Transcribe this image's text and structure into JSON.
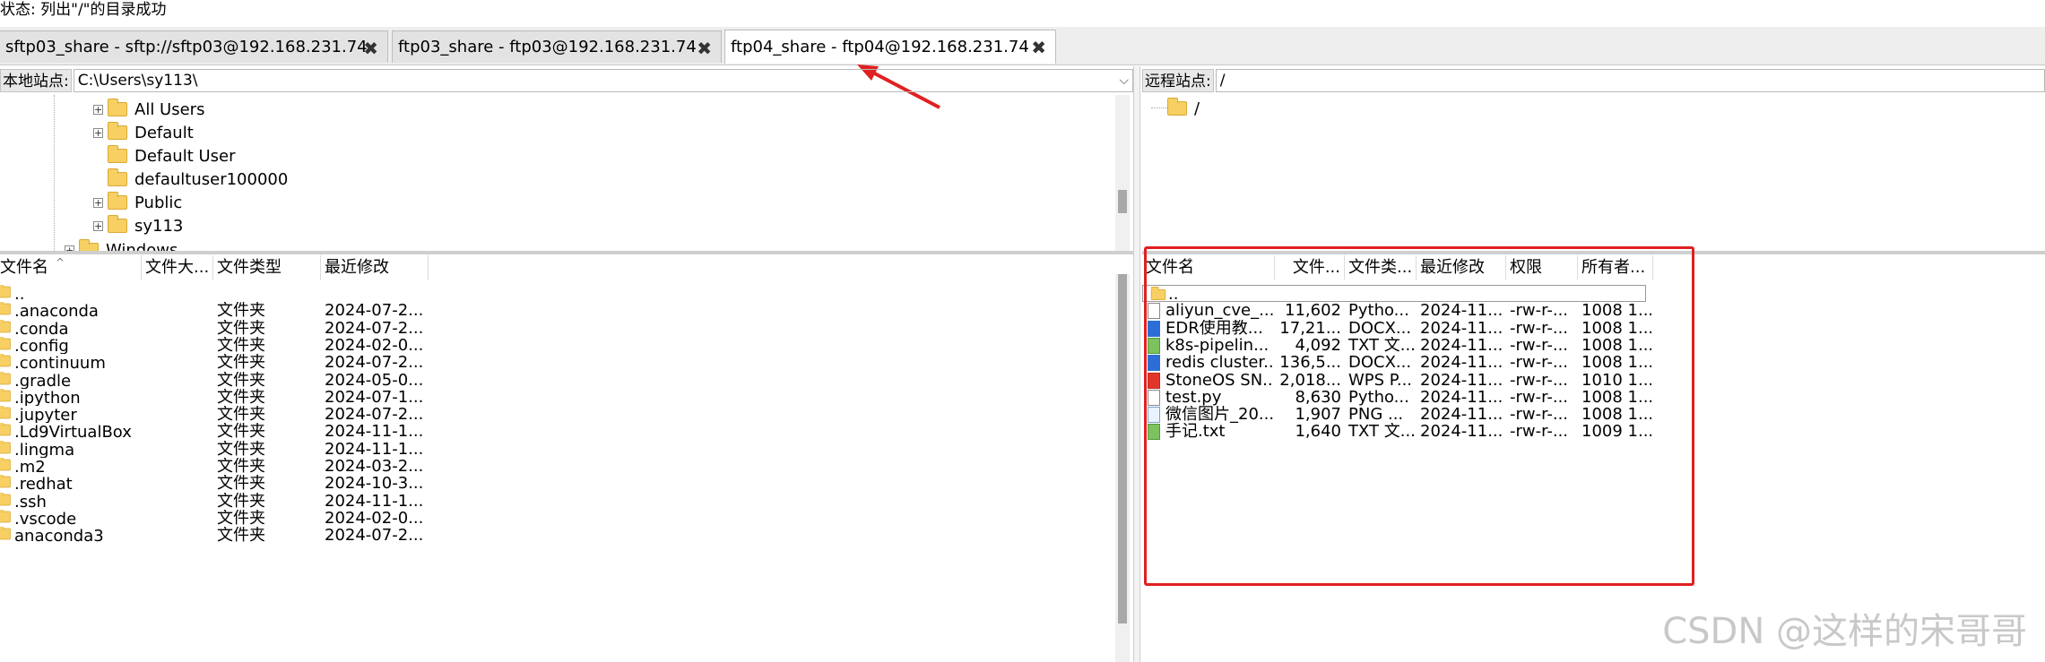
{
  "status_line": "状态: 列出\"/\"的目录成功",
  "tabs": [
    {
      "label": "sftp03_share - sftp://sftp03@192.168.231.74",
      "close": "✖"
    },
    {
      "label": "ftp03_share - ftp03@192.168.231.74",
      "close": "✖"
    },
    {
      "label": "ftp04_share - ftp04@192.168.231.74",
      "close": "✖"
    }
  ],
  "local": {
    "site_label": "本地站点:",
    "path": "C:\\Users\\sy113\\",
    "tree": [
      {
        "label": "All Users",
        "expander": "+"
      },
      {
        "label": "Default",
        "expander": "+"
      },
      {
        "label": "Default User",
        "expander": ""
      },
      {
        "label": "defaultuser100000",
        "expander": ""
      },
      {
        "label": "Public",
        "expander": "+"
      },
      {
        "label": "sy113",
        "expander": "+"
      },
      {
        "label": "Windows",
        "expander": "+"
      }
    ],
    "columns": [
      "文件名",
      "文件大...",
      "文件类型",
      "最近修改"
    ],
    "rows": [
      {
        "name": "..",
        "size": "",
        "type": "",
        "modified": ""
      },
      {
        "name": ".anaconda",
        "size": "",
        "type": "文件夹",
        "modified": "2024-07-2..."
      },
      {
        "name": ".conda",
        "size": "",
        "type": "文件夹",
        "modified": "2024-07-2..."
      },
      {
        "name": ".config",
        "size": "",
        "type": "文件夹",
        "modified": "2024-02-0..."
      },
      {
        "name": ".continuum",
        "size": "",
        "type": "文件夹",
        "modified": "2024-07-2..."
      },
      {
        "name": ".gradle",
        "size": "",
        "type": "文件夹",
        "modified": "2024-05-0..."
      },
      {
        "name": ".ipython",
        "size": "",
        "type": "文件夹",
        "modified": "2024-07-1..."
      },
      {
        "name": ".jupyter",
        "size": "",
        "type": "文件夹",
        "modified": "2024-07-2..."
      },
      {
        "name": ".Ld9VirtualBox",
        "size": "",
        "type": "文件夹",
        "modified": "2024-11-1..."
      },
      {
        "name": ".lingma",
        "size": "",
        "type": "文件夹",
        "modified": "2024-11-1..."
      },
      {
        "name": ".m2",
        "size": "",
        "type": "文件夹",
        "modified": "2024-03-2..."
      },
      {
        "name": ".redhat",
        "size": "",
        "type": "文件夹",
        "modified": "2024-10-3..."
      },
      {
        "name": ".ssh",
        "size": "",
        "type": "文件夹",
        "modified": "2024-11-1..."
      },
      {
        "name": ".vscode",
        "size": "",
        "type": "文件夹",
        "modified": "2024-02-0..."
      },
      {
        "name": "anaconda3",
        "size": "",
        "type": "文件夹",
        "modified": "2024-07-2..."
      }
    ]
  },
  "remote": {
    "site_label": "远程站点:",
    "path": "/",
    "tree": [
      {
        "label": "/"
      }
    ],
    "columns": [
      "文件名",
      "文件...",
      "文件类...",
      "最近修改",
      "权限",
      "所有者..."
    ],
    "rows": [
      {
        "name": "..",
        "size": "",
        "type": "",
        "modified": "",
        "perm": "",
        "owner": "",
        "icon": "folder-icon"
      },
      {
        "name": "aliyun_cve_...",
        "size": "11,602",
        "type": "Pytho...",
        "modified": "2024-11...",
        "perm": "-rw-r-...",
        "owner": "1008 1...",
        "icon": "file-icon"
      },
      {
        "name": "EDR使用教...",
        "size": "17,21...",
        "type": "DOCX...",
        "modified": "2024-11...",
        "perm": "-rw-r-...",
        "owner": "1008 1...",
        "icon": "docx-icon"
      },
      {
        "name": "k8s-pipelin...",
        "size": "4,092",
        "type": "TXT 文...",
        "modified": "2024-11...",
        "perm": "-rw-r-...",
        "owner": "1008 1...",
        "icon": "txt-icon"
      },
      {
        "name": "redis cluster...",
        "size": "136,5...",
        "type": "DOCX...",
        "modified": "2024-11...",
        "perm": "-rw-r-...",
        "owner": "1008 1...",
        "icon": "docx-icon"
      },
      {
        "name": "StoneOS SN...",
        "size": "2,018...",
        "type": "WPS P...",
        "modified": "2024-11...",
        "perm": "-rw-r-...",
        "owner": "1010 1...",
        "icon": "wps-icon"
      },
      {
        "name": "test.py",
        "size": "8,630",
        "type": "Pytho...",
        "modified": "2024-11...",
        "perm": "-rw-r-...",
        "owner": "1008 1...",
        "icon": "file-icon"
      },
      {
        "name": "微信图片_20...",
        "size": "1,907",
        "type": "PNG ...",
        "modified": "2024-11...",
        "perm": "-rw-r-...",
        "owner": "1008 1...",
        "icon": "png-icon"
      },
      {
        "name": "手记.txt",
        "size": "1,640",
        "type": "TXT 文...",
        "modified": "2024-11...",
        "perm": "-rw-r-...",
        "owner": "1009 1...",
        "icon": "txt-icon"
      }
    ]
  },
  "watermark": "CSDN @这样的宋哥哥",
  "colors": {
    "annotation": "#e02020",
    "folder": "#f7cf62"
  }
}
